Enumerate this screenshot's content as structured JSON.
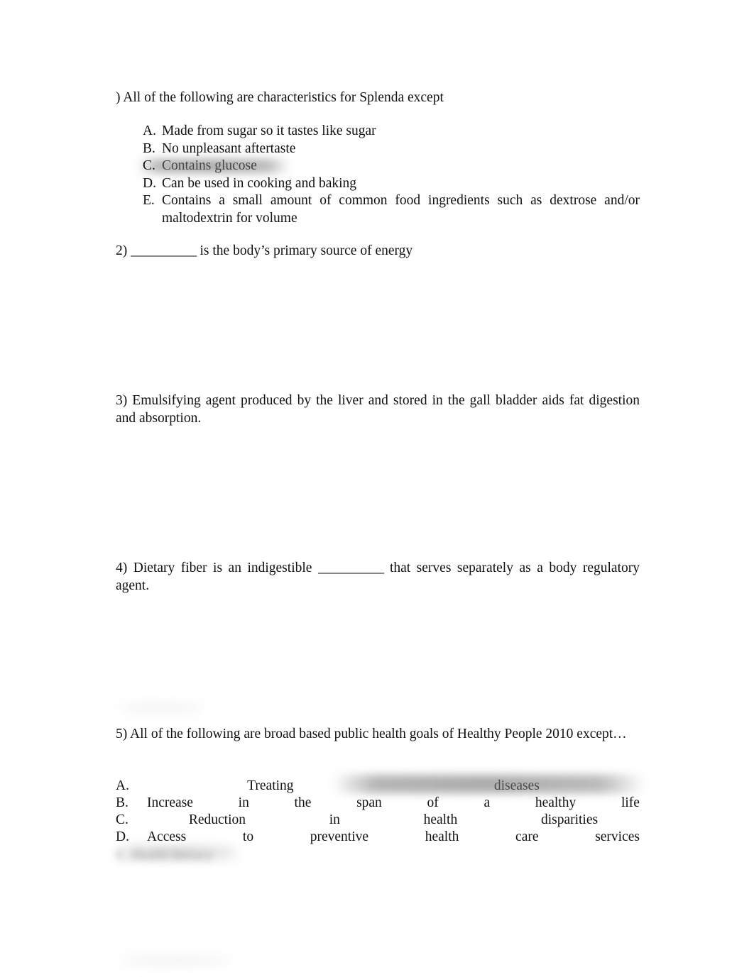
{
  "document": {
    "type": "quiz-worksheet",
    "page_background": "#ffffff",
    "text_color": "#111111"
  },
  "questions": [
    {
      "number": ")",
      "stem": ") All of the following are characteristics for Splenda except",
      "options": [
        {
          "letter": "A.",
          "text": "Made from sugar so it tastes like sugar",
          "highlighted": false
        },
        {
          "letter": "B.",
          "text": "No unpleasant aftertaste",
          "highlighted": false
        },
        {
          "letter": "C.",
          "text": "Contains glucose",
          "highlighted": true
        },
        {
          "letter": "D.",
          "text": "Can be used in cooking and baking",
          "highlighted": false
        },
        {
          "letter": "E.",
          "text": "Contains a small amount of common food ingredients such as dextrose and/or maltodextrin for volume",
          "highlighted": false
        }
      ]
    },
    {
      "number": "2)",
      "stem_before_blank": "2) ",
      "blank": "__________",
      "stem_after_blank": " is the body’s primary source of energy"
    },
    {
      "number": "3)",
      "stem": "3) Emulsifying agent produced by the liver and stored in the gall bladder aids fat digestion and absorption."
    },
    {
      "number": "4)",
      "stem_before_blank": "4) Dietary fiber is an indigestible ",
      "blank": "__________",
      "stem_after_blank": " that serves separately as a body regulatory agent."
    },
    {
      "number": "5)",
      "stem": "5) All of the following are broad based public health goals of Healthy People 2010 except…",
      "spread_options": [
        {
          "letter": "A.",
          "words": [
            "Treating",
            "diseases"
          ],
          "obscured": true,
          "layout": "centerish"
        },
        {
          "letter": "B.",
          "words": [
            "Increase",
            "in",
            "the",
            "span",
            "of",
            "a",
            "healthy",
            "life"
          ],
          "obscured": false,
          "layout": "wide"
        },
        {
          "letter": "C.",
          "words": [
            "Reduction",
            "in",
            "health",
            "disparities"
          ],
          "obscured": false,
          "layout": "centerish"
        },
        {
          "letter": "D.",
          "words": [
            "Access",
            "to",
            "preventive",
            "health",
            "care",
            "services"
          ],
          "obscured": false,
          "layout": "wide"
        }
      ],
      "obscured_option_e": "E. Health literacy"
    }
  ],
  "artifacts": {
    "highlight_note": "gray blurred smear over option C of question 1",
    "band_note": "gray blurred band covering middle of option A in question 5",
    "ghost_line_above_q5": "illegible blurred text line",
    "ghost_line_bottom": "illegible blurred text line"
  }
}
